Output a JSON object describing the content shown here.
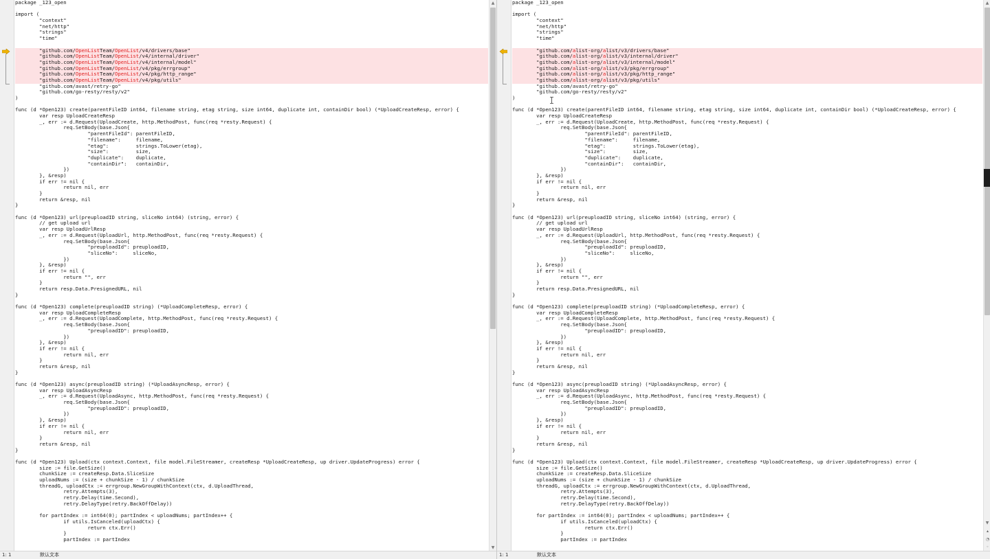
{
  "left": {
    "lines": [
      "package _123_open",
      "",
      "import (",
      "\t\"context\"",
      "\t\"net/http\"",
      "\t\"strings\"",
      "\t\"time\"",
      "",
      {
        "diff": true,
        "segs": [
          "\t\"github.com/",
          {
            "h": "OpenList"
          },
          "Team/",
          {
            "h": "OpenList"
          },
          "/v4/drivers/base\""
        ]
      },
      {
        "diff": true,
        "segs": [
          "\t\"github.com/",
          {
            "h": "OpenList"
          },
          "Team/",
          {
            "h": "OpenList"
          },
          "/v4/internal/driver\""
        ]
      },
      {
        "diff": true,
        "segs": [
          "\t\"github.com/",
          {
            "h": "OpenList"
          },
          "Team/",
          {
            "h": "OpenList"
          },
          "/v4/internal/model\""
        ]
      },
      {
        "diff": true,
        "segs": [
          "\t\"github.com/",
          {
            "h": "OpenList"
          },
          "Team/",
          {
            "h": "OpenList"
          },
          "/v4/pkg/errgroup\""
        ]
      },
      {
        "diff": true,
        "segs": [
          "\t\"github.com/",
          {
            "h": "OpenList"
          },
          "Team/",
          {
            "h": "OpenList"
          },
          "/v4/pkg/http_range\""
        ]
      },
      {
        "diff": true,
        "segs": [
          "\t\"github.com/",
          {
            "h": "OpenList"
          },
          "Team/",
          {
            "h": "OpenList"
          },
          "/v4/pkg/utils\""
        ]
      },
      "\t\"github.com/avast/retry-go\"",
      "\t\"github.com/go-resty/resty/v2\"",
      ")",
      "",
      "func (d *Open123) create(parentFileID int64, filename string, etag string, size int64, duplicate int, containDir bool) (*UploadCreateResp, error) {",
      "\tvar resp UploadCreateResp",
      "\t_, err := d.Request(UploadCreate, http.MethodPost, func(req *resty.Request) {",
      "\t\treq.SetBody(base.Json{",
      "\t\t\t\"parentFileId\": parentFileID,",
      "\t\t\t\"filename\":     filename,",
      "\t\t\t\"etag\":         strings.ToLower(etag),",
      "\t\t\t\"size\":         size,",
      "\t\t\t\"duplicate\":    duplicate,",
      "\t\t\t\"containDir\":   containDir,",
      "\t\t})",
      "\t}, &resp)",
      "\tif err != nil {",
      "\t\treturn nil, err",
      "\t}",
      "\treturn &resp, nil",
      "}",
      "",
      "func (d *Open123) url(preuploadID string, sliceNo int64) (string, error) {",
      "\t// get upload url",
      "\tvar resp UploadUrlResp",
      "\t_, err := d.Request(UploadUrl, http.MethodPost, func(req *resty.Request) {",
      "\t\treq.SetBody(base.Json{",
      "\t\t\t\"preuploadId\": preuploadID,",
      "\t\t\t\"sliceNo\":     sliceNo,",
      "\t\t})",
      "\t}, &resp)",
      "\tif err != nil {",
      "\t\treturn \"\", err",
      "\t}",
      "\treturn resp.Data.PresignedURL, nil",
      "}",
      "",
      "func (d *Open123) complete(preuploadID string) (*UploadCompleteResp, error) {",
      "\tvar resp UploadCompleteResp",
      "\t_, err := d.Request(UploadComplete, http.MethodPost, func(req *resty.Request) {",
      "\t\treq.SetBody(base.Json{",
      "\t\t\t\"preuploadID\": preuploadID,",
      "\t\t})",
      "\t}, &resp)",
      "\tif err != nil {",
      "\t\treturn nil, err",
      "\t}",
      "\treturn &resp, nil",
      "}",
      "",
      "func (d *Open123) async(preuploadID string) (*UploadAsyncResp, error) {",
      "\tvar resp UploadAsyncResp",
      "\t_, err := d.Request(UploadAsync, http.MethodPost, func(req *resty.Request) {",
      "\t\treq.SetBody(base.Json{",
      "\t\t\t\"preuploadID\": preuploadID,",
      "\t\t})",
      "\t}, &resp)",
      "\tif err != nil {",
      "\t\treturn nil, err",
      "\t}",
      "\treturn &resp, nil",
      "}",
      "",
      "func (d *Open123) Upload(ctx context.Context, file model.FileStreamer, createResp *UploadCreateResp, up driver.UpdateProgress) error {",
      "\tsize := file.GetSize()",
      "\tchunkSize := createResp.Data.SliceSize",
      "\tuploadNums := (size + chunkSize - 1) / chunkSize",
      "\tthreadG, uploadCtx := errgroup.NewGroupWithContext(ctx, d.UploadThread,",
      "\t\tretry.Attempts(3),",
      "\t\tretry.Delay(time.Second),",
      "\t\tretry.DelayType(retry.BackOffDelay))",
      "",
      "\tfor partIndex := int64(0); partIndex < uploadNums; partIndex++ {",
      "\t\tif utils.IsCanceled(uploadCtx) {",
      "\t\t\treturn ctx.Err()",
      "\t\t}",
      "\t\tpartIndex := partIndex"
    ],
    "status": {
      "position": "1: 1",
      "encoding": "默认文本"
    }
  },
  "right": {
    "lines": [
      "package _123_open",
      "",
      "import (",
      "\t\"context\"",
      "\t\"net/http\"",
      "\t\"strings\"",
      "\t\"time\"",
      "",
      {
        "diff": true,
        "segs": [
          "\t\"github.com/",
          {
            "h": "a"
          },
          "list-org/",
          {
            "h": "a"
          },
          "list/v3/drivers/base\""
        ]
      },
      {
        "diff": true,
        "segs": [
          "\t\"github.com/",
          {
            "h": "a"
          },
          "list-org/",
          {
            "h": "a"
          },
          "list/v3/internal/driver\""
        ]
      },
      {
        "diff": true,
        "segs": [
          "\t\"github.com/",
          {
            "h": "a"
          },
          "list-org/",
          {
            "h": "a"
          },
          "list/v3/internal/model\""
        ]
      },
      {
        "diff": true,
        "segs": [
          "\t\"github.com/",
          {
            "h": "a"
          },
          "list-org/",
          {
            "h": "a"
          },
          "list/v3/pkg/errgroup\""
        ]
      },
      {
        "diff": true,
        "segs": [
          "\t\"github.com/",
          {
            "h": "a"
          },
          "list-org/",
          {
            "h": "a"
          },
          "list/v3/pkg/http_range\""
        ]
      },
      {
        "diff": true,
        "segs": [
          "\t\"github.com/",
          {
            "h": "a"
          },
          "list-org/",
          {
            "h": "a"
          },
          "list/v3/pkg/utils\""
        ]
      },
      "\t\"github.com/avast/retry-go\"",
      "\t\"github.com/go-resty/resty/v2\"",
      ")",
      "",
      "func (d *Open123) create(parentFileID int64, filename string, etag string, size int64, duplicate int, containDir bool) (*UploadCreateResp, error) {",
      "\tvar resp UploadCreateResp",
      "\t_, err := d.Request(UploadCreate, http.MethodPost, func(req *resty.Request) {",
      "\t\treq.SetBody(base.Json{",
      "\t\t\t\"parentFileId\": parentFileID,",
      "\t\t\t\"filename\":     filename,",
      "\t\t\t\"etag\":         strings.ToLower(etag),",
      "\t\t\t\"size\":         size,",
      "\t\t\t\"duplicate\":    duplicate,",
      "\t\t\t\"containDir\":   containDir,",
      "\t\t})",
      "\t}, &resp)",
      "\tif err != nil {",
      "\t\treturn nil, err",
      "\t}",
      "\treturn &resp, nil",
      "}",
      "",
      "func (d *Open123) url(preuploadID string, sliceNo int64) (string, error) {",
      "\t// get upload url",
      "\tvar resp UploadUrlResp",
      "\t_, err := d.Request(UploadUrl, http.MethodPost, func(req *resty.Request) {",
      "\t\treq.SetBody(base.Json{",
      "\t\t\t\"preuploadId\": preuploadID,",
      "\t\t\t\"sliceNo\":     sliceNo,",
      "\t\t})",
      "\t}, &resp)",
      "\tif err != nil {",
      "\t\treturn \"\", err",
      "\t}",
      "\treturn resp.Data.PresignedURL, nil",
      "}",
      "",
      "func (d *Open123) complete(preuploadID string) (*UploadCompleteResp, error) {",
      "\tvar resp UploadCompleteResp",
      "\t_, err := d.Request(UploadComplete, http.MethodPost, func(req *resty.Request) {",
      "\t\treq.SetBody(base.Json{",
      "\t\t\t\"preuploadID\": preuploadID,",
      "\t\t})",
      "\t}, &resp)",
      "\tif err != nil {",
      "\t\treturn nil, err",
      "\t}",
      "\treturn &resp, nil",
      "}",
      "",
      "func (d *Open123) async(preuploadID string) (*UploadAsyncResp, error) {",
      "\tvar resp UploadAsyncResp",
      "\t_, err := d.Request(UploadAsync, http.MethodPost, func(req *resty.Request) {",
      "\t\treq.SetBody(base.Json{",
      "\t\t\t\"preuploadID\": preuploadID,",
      "\t\t})",
      "\t}, &resp)",
      "\tif err != nil {",
      "\t\treturn nil, err",
      "\t}",
      "\treturn &resp, nil",
      "}",
      "",
      "func (d *Open123) Upload(ctx context.Context, file model.FileStreamer, createResp *UploadCreateResp, up driver.UpdateProgress) error {",
      "\tsize := file.GetSize()",
      "\tchunkSize := createResp.Data.SliceSize",
      "\tuploadNums := (size + chunkSize - 1) / chunkSize",
      "\tthreadG, uploadCtx := errgroup.NewGroupWithContext(ctx, d.UploadThread,",
      "\t\tretry.Attempts(3),",
      "\t\tretry.Delay(time.Second),",
      "\t\tretry.DelayType(retry.BackOffDelay))",
      "",
      "\tfor partIndex := int64(0); partIndex < uploadNums; partIndex++ {",
      "\t\tif utils.IsCanceled(uploadCtx) {",
      "\t\t\treturn ctx.Err()",
      "\t\t}",
      "\t\tpartIndex := partIndex"
    ],
    "status": {
      "position": "1: 1",
      "encoding": "默认文本"
    }
  },
  "colors": {
    "diff_bg": "#fde1e3",
    "diff_text": "#e02020",
    "arrow": "#f0b400"
  },
  "icons": [
    "diff-arrow-icon",
    "scroll-up-arrow-icon",
    "scroll-down-arrow-icon",
    "text-cursor-icon"
  ]
}
